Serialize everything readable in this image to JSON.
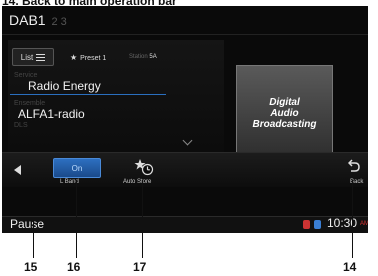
{
  "caption": "14. Back to main operation bar",
  "header": {
    "band": "DAB1",
    "other_bands": "2 3"
  },
  "info": {
    "list_label": "List",
    "preset_label": "Preset 1",
    "station_label": "Station",
    "station_value": "5A",
    "service_label": "Service",
    "service_value": "Radio Energy",
    "ensemble_label": "Ensemble",
    "ensemble_value": "ALFA1-radio",
    "dls_label": "DLS"
  },
  "logo_lines": [
    "Digital",
    "Audio",
    "Broadcasting"
  ],
  "controls": {
    "lband_state": "On",
    "lband_label": "L Band",
    "autostore_label": "Auto Store",
    "back_label": "Back"
  },
  "status": {
    "text": "Pause",
    "time": "10:30",
    "ampm": "AM"
  },
  "callouts": [
    "15",
    "16",
    "17",
    "14"
  ],
  "colors": {
    "accent": "#2a6fbf",
    "background": "#0a0a0a"
  }
}
